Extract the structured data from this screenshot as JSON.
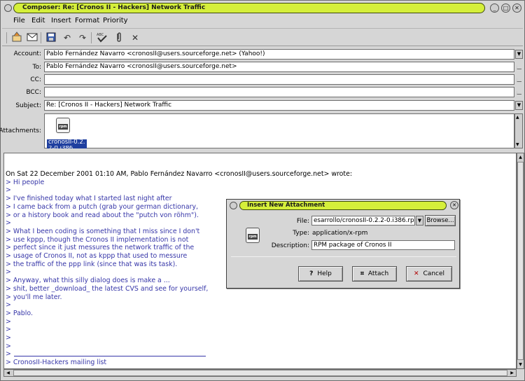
{
  "window": {
    "title": "Composer: Re: [Cronos II - Hackers] Network Traffic"
  },
  "menubar": {
    "items": [
      {
        "label": "File"
      },
      {
        "label": "Edit"
      },
      {
        "label": "Insert"
      },
      {
        "label": "Format"
      },
      {
        "label": "Priority"
      }
    ]
  },
  "toolbar": {
    "icons": [
      "send-icon",
      "send-later-icon",
      "save-icon",
      "undo-icon",
      "redo-icon",
      "spell-check-icon",
      "attach-icon",
      "close-icon"
    ]
  },
  "headers": {
    "account_label": "Account:",
    "account_value": "Pablo Fernández Navarro <cronosII@users.sourceforge.net> (Yahoo!)",
    "to_label": "To:",
    "to_value": "Pablo Fernández Navarro <cronosII@users.sourceforge.net>",
    "cc_label": "CC:",
    "cc_value": "",
    "bcc_label": "BCC:",
    "bcc_value": "",
    "subject_label": "Subject:",
    "subject_value": "Re: [Cronos II - Hackers] Network Traffic",
    "attachments_label": "Attachments:",
    "attachment_name": "cronosII-0.2.",
    "attachment_name_2": "2-0.i386"
  },
  "body": {
    "lines": [
      {
        "text": "On Sat 22 December 2001 01:10 AM, Pablo Fernández Navarro <cronosII@users.sourceforge.net> wrote:",
        "quote": false
      },
      {
        "text": "> Hi people",
        "quote": true
      },
      {
        "text": ">",
        "quote": true
      },
      {
        "text": "> I've finished today what I started last night after",
        "quote": true
      },
      {
        "text": "> I came back from a putch (grab your german dictionary,",
        "quote": true
      },
      {
        "text": "> or a history book and read about the \"putch von röhm\").",
        "quote": true
      },
      {
        "text": ">",
        "quote": true
      },
      {
        "text": "> What I been coding is something that I miss since I don't",
        "quote": true
      },
      {
        "text": "> use kppp, though the Cronos II implementation is not",
        "quote": true
      },
      {
        "text": "> perfect since it just messures the network traffic of the",
        "quote": true
      },
      {
        "text": "> usage of Cronos II, not as kppp that used to messure",
        "quote": true
      },
      {
        "text": "> the traffic of the ppp link (since that was its task).",
        "quote": true
      },
      {
        "text": ">",
        "quote": true
      },
      {
        "text": "> Anyway, what this silly dialog does is make a ...",
        "quote": true
      },
      {
        "text": "> shit, better _download_ the latest CVS and see for yourself,",
        "quote": true
      },
      {
        "text": "> you'll me later.",
        "quote": true
      },
      {
        "text": ">",
        "quote": true
      },
      {
        "text": "> Pablo.",
        "quote": true
      },
      {
        "text": ">",
        "quote": true
      },
      {
        "text": ">",
        "quote": true
      },
      {
        "text": ">",
        "quote": true
      },
      {
        "text": ">",
        "quote": true
      },
      {
        "text": ">",
        "quote": true
      },
      {
        "text": "> CronosII-Hackers mailing list",
        "quote": true
      }
    ]
  },
  "dialog": {
    "title": "Insert New Attachment",
    "file_label": "File:",
    "file_value": "esarrollo/cronosII-0.2.2-0.i386.rpm",
    "browse_label": "Browse...",
    "type_label": "Type:",
    "type_value": "application/x-rpm",
    "description_label": "Description:",
    "description_value": "RPM package of Cronos II",
    "help_label": "Help",
    "attach_label": "Attach",
    "cancel_label": "Cancel"
  },
  "icon_label": "rpm"
}
